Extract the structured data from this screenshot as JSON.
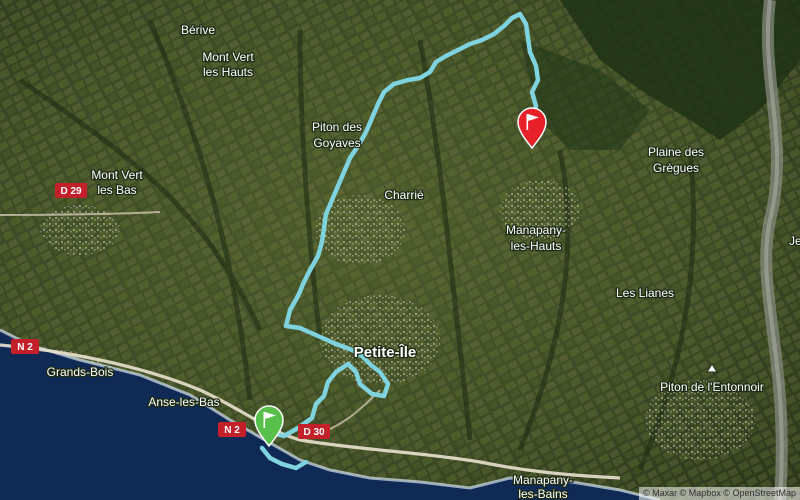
{
  "map": {
    "type": "satellite",
    "place_labels": {
      "berive": "Bérive",
      "mont_vert_les_hauts": [
        "Mont Vert",
        "les Hauts"
      ],
      "piton_des_goyaves": [
        "Piton des",
        "Goyaves"
      ],
      "charrie": "Charrié",
      "plaine_des_gregues": [
        "Plaine des",
        "Grègues"
      ],
      "mont_vert_les_bas": [
        "Mont Vert",
        "les Bas"
      ],
      "manapany_les_hauts": [
        "Manapany-",
        "les-Hauts"
      ],
      "les_lianes": "Les Lianes",
      "petite_ile": "Petite-Île",
      "grands_bois": "Grands-Bois",
      "anse_les_bas": "Anse-les-Bas",
      "piton_entonnoir": "Piton de l'Entonnoir",
      "manapany_les_bains": [
        "Manapany-",
        "les-Bains"
      ],
      "edge_partial": "Je"
    },
    "road_shields": {
      "d29": "D 29",
      "n2_west": "N 2",
      "n2_coast": "N 2",
      "d30": "D 30"
    },
    "markers": {
      "start": {
        "icon": "start-flag-icon",
        "color": "#58c04a"
      },
      "end": {
        "icon": "finish-flag-icon",
        "color": "#e8202a"
      }
    },
    "colors": {
      "route": "#7fd3de",
      "ocean": "#0e2a55",
      "road_shield": "#c4202a"
    },
    "attribution": "© Maxar © Mapbox © OpenStreetMap"
  }
}
